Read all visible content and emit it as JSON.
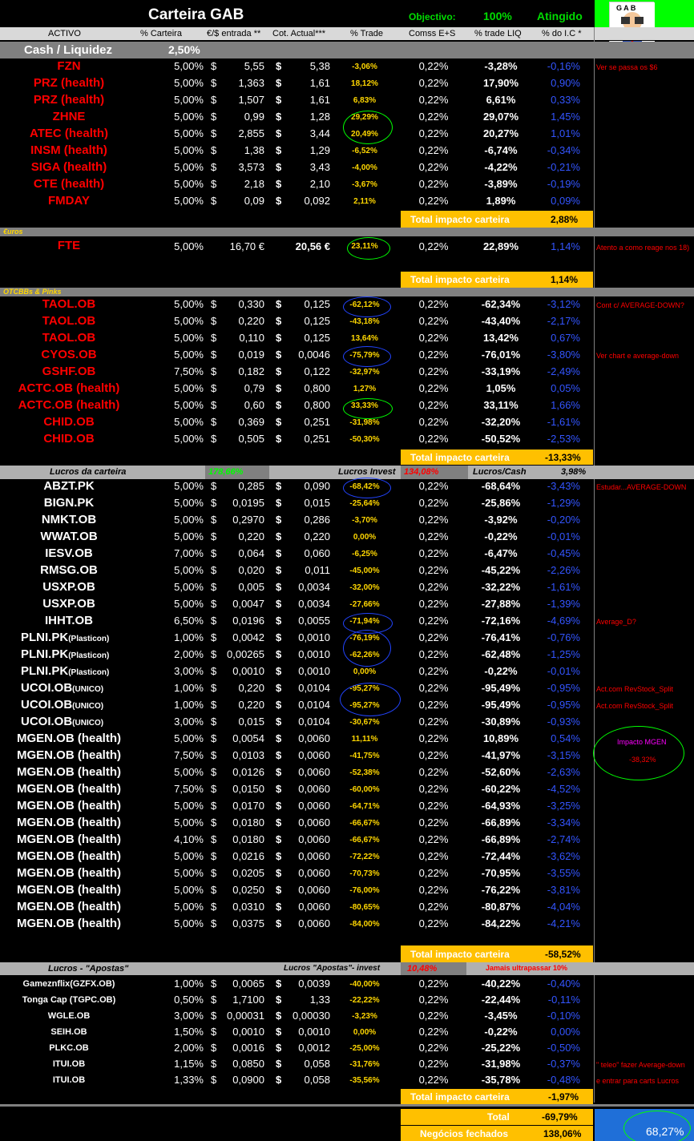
{
  "title": "Carteira GAB",
  "objective_label": "Objectivo:",
  "objective_value": "100%",
  "objective_status": "Atingido",
  "logo_text": "G A B",
  "headers": [
    "ACTIVO",
    "% Carteira",
    "€/$ entrada **",
    "Cot. Actual***",
    "% Trade",
    "Comss E+S",
    "% trade LIQ",
    "% do I.C *"
  ],
  "cash": {
    "label": "Cash / Liquidez",
    "value": "2,50%"
  },
  "group1": [
    {
      "a": "FZN",
      "p": "5,00%",
      "d1": "$",
      "e": "5,55",
      "d2": "$",
      "c": "5,38",
      "t": "-3,06%",
      "m": "0,22%",
      "l": "-3,28%",
      "i": "-0,16%",
      "n": "Ver se passa os $6"
    },
    {
      "a": "PRZ  (health)",
      "p": "5,00%",
      "d1": "$",
      "e": "1,363",
      "d2": "$",
      "c": "1,61",
      "t": "18,12%",
      "m": "0,22%",
      "l": "17,90%",
      "i": "0,90%",
      "n": ""
    },
    {
      "a": "PRZ  (health)",
      "p": "5,00%",
      "d1": "$",
      "e": "1,507",
      "d2": "$",
      "c": "1,61",
      "t": "6,83%",
      "m": "0,22%",
      "l": "6,61%",
      "i": "0,33%",
      "n": ""
    },
    {
      "a": "ZHNE",
      "p": "5,00%",
      "d1": "$",
      "e": "0,99",
      "d2": "$",
      "c": "1,28",
      "t": "29,29%",
      "m": "0,22%",
      "l": "29,07%",
      "i": "1,45%",
      "n": ""
    },
    {
      "a": "ATEC  (health)",
      "p": "5,00%",
      "d1": "$",
      "e": "2,855",
      "d2": "$",
      "c": "3,44",
      "t": "20,49%",
      "m": "0,22%",
      "l": "20,27%",
      "i": "1,01%",
      "n": ""
    },
    {
      "a": "INSM  (health)",
      "p": "5,00%",
      "d1": "$",
      "e": "1,38",
      "d2": "$",
      "c": "1,29",
      "t": "-6,52%",
      "m": "0,22%",
      "l": "-6,74%",
      "i": "-0,34%",
      "n": ""
    },
    {
      "a": "SIGA  (health)",
      "p": "5,00%",
      "d1": "$",
      "e": "3,573",
      "d2": "$",
      "c": "3,43",
      "t": "-4,00%",
      "m": "0,22%",
      "l": "-4,22%",
      "i": "-0,21%",
      "n": ""
    },
    {
      "a": "CTE  (health)",
      "p": "5,00%",
      "d1": "$",
      "e": "2,18",
      "d2": "$",
      "c": "2,10",
      "t": "-3,67%",
      "m": "0,22%",
      "l": "-3,89%",
      "i": "-0,19%",
      "n": ""
    },
    {
      "a": "FMDAY",
      "p": "5,00%",
      "d1": "$",
      "e": "0,09",
      "d2": "$",
      "c": "0,092",
      "t": "2,11%",
      "m": "0,22%",
      "l": "1,89%",
      "i": "0,09%",
      "n": ""
    }
  ],
  "total1": {
    "label": "Total impacto carteira",
    "value": "2,88%"
  },
  "euros_label": "€uros",
  "fte": {
    "a": "FTE",
    "p": "5,00%",
    "e": "16,70 €",
    "c": "20,56 €",
    "t": "23,11%",
    "m": "0,22%",
    "l": "22,89%",
    "i": "1,14%",
    "n": "Atento a como reage nos 18)"
  },
  "total2": {
    "label": "Total impacto carteira",
    "value": "1,14%"
  },
  "otc_label": "OTCBBs & Pinks",
  "group2": [
    {
      "a": "TAOL.OB",
      "p": "5,00%",
      "d1": "$",
      "e": "0,330",
      "d2": "$",
      "c": "0,125",
      "t": "-62,12%",
      "m": "0,22%",
      "l": "-62,34%",
      "i": "-3,12%",
      "n": "Cont c/  AVERAGE-DOWN?"
    },
    {
      "a": "TAOL.OB",
      "p": "5,00%",
      "d1": "$",
      "e": "0,220",
      "d2": "$",
      "c": "0,125",
      "t": "-43,18%",
      "m": "0,22%",
      "l": "-43,40%",
      "i": "-2,17%",
      "n": ""
    },
    {
      "a": "TAOL.OB",
      "p": "5,00%",
      "d1": "$",
      "e": "0,110",
      "d2": "$",
      "c": "0,125",
      "t": "13,64%",
      "m": "0,22%",
      "l": "13,42%",
      "i": "0,67%",
      "n": ""
    },
    {
      "a": "CYOS.OB",
      "p": "5,00%",
      "d1": "$",
      "e": "0,019",
      "d2": "$",
      "c": "0,0046",
      "t": "-75,79%",
      "m": "0,22%",
      "l": "-76,01%",
      "i": "-3,80%",
      "n": "Ver chart e average-down"
    },
    {
      "a": "GSHF.OB",
      "p": "7,50%",
      "d1": "$",
      "e": "0,182",
      "d2": "$",
      "c": "0,122",
      "t": "-32,97%",
      "m": "0,22%",
      "l": "-33,19%",
      "i": "-2,49%",
      "n": ""
    },
    {
      "a": "ACTC.OB  (health)",
      "p": "5,00%",
      "d1": "$",
      "e": "0,79",
      "d2": "$",
      "c": "0,800",
      "t": "1,27%",
      "m": "0,22%",
      "l": "1,05%",
      "i": "0,05%",
      "n": ""
    },
    {
      "a": "ACTC.OB  (health)",
      "p": "5,00%",
      "d1": "$",
      "e": "0,60",
      "d2": "$",
      "c": "0,800",
      "t": "33,33%",
      "m": "0,22%",
      "l": "33,11%",
      "i": "1,66%",
      "n": ""
    },
    {
      "a": "CHID.OB",
      "p": "5,00%",
      "d1": "$",
      "e": "0,369",
      "d2": "$",
      "c": "0,251",
      "t": "-31,98%",
      "m": "0,22%",
      "l": "-32,20%",
      "i": "-1,61%",
      "n": ""
    },
    {
      "a": "CHID.OB",
      "p": "5,00%",
      "d1": "$",
      "e": "0,505",
      "d2": "$",
      "c": "0,251",
      "t": "-50,30%",
      "m": "0,22%",
      "l": "-50,52%",
      "i": "-2,53%",
      "n": ""
    }
  ],
  "total3": {
    "label": "Total impacto carteira",
    "value": "-13,33%"
  },
  "lucros_bar": {
    "l1": "Lucros da carteira",
    "v1": "178,66%",
    "l2": "Lucros Invest",
    "v2": "134,08%",
    "l3": "Lucros/Cash",
    "v3": "3,98%"
  },
  "group3": [
    {
      "a": "ABZT.PK",
      "p": "5,00%",
      "d1": "$",
      "e": "0,285",
      "d2": "$",
      "c": "0,090",
      "t": "-68,42%",
      "m": "0,22%",
      "l": "-68,64%",
      "i": "-3,43%",
      "n": "Estudar...AVERAGE-DOWN"
    },
    {
      "a": "BIGN.PK",
      "p": "5,00%",
      "d1": "$",
      "e": "0,0195",
      "d2": "$",
      "c": "0,015",
      "t": "-25,64%",
      "m": "0,22%",
      "l": "-25,86%",
      "i": "-1,29%",
      "n": ""
    },
    {
      "a": "NMKT.OB",
      "p": "5,00%",
      "d1": "$",
      "e": "0,2970",
      "d2": "$",
      "c": "0,286",
      "t": "-3,70%",
      "m": "0,22%",
      "l": "-3,92%",
      "i": "-0,20%",
      "n": ""
    },
    {
      "a": "WWAT.OB",
      "p": "5,00%",
      "d1": "$",
      "e": "0,220",
      "d2": "$",
      "c": "0,220",
      "t": "0,00%",
      "m": "0,22%",
      "l": "-0,22%",
      "i": "-0,01%",
      "n": ""
    },
    {
      "a": "IESV.OB",
      "p": "7,00%",
      "d1": "$",
      "e": "0,064",
      "d2": "$",
      "c": "0,060",
      "t": "-6,25%",
      "m": "0,22%",
      "l": "-6,47%",
      "i": "-0,45%",
      "n": ""
    },
    {
      "a": "RMSG.OB",
      "p": "5,00%",
      "d1": "$",
      "e": "0,020",
      "d2": "$",
      "c": "0,011",
      "t": "-45,00%",
      "m": "0,22%",
      "l": "-45,22%",
      "i": "-2,26%",
      "n": ""
    },
    {
      "a": "USXP.OB",
      "p": "5,00%",
      "d1": "$",
      "e": "0,005",
      "d2": "$",
      "c": "0,0034",
      "t": "-32,00%",
      "m": "0,22%",
      "l": "-32,22%",
      "i": "-1,61%",
      "n": ""
    },
    {
      "a": "USXP.OB",
      "p": "5,00%",
      "d1": "$",
      "e": "0,0047",
      "d2": "$",
      "c": "0,0034",
      "t": "-27,66%",
      "m": "0,22%",
      "l": "-27,88%",
      "i": "-1,39%",
      "n": ""
    },
    {
      "a": "IHHT.OB",
      "p": "6,50%",
      "d1": "$",
      "e": "0,0196",
      "d2": "$",
      "c": "0,0055",
      "t": "-71,94%",
      "m": "0,22%",
      "l": "-72,16%",
      "i": "-4,69%",
      "n": "Average_D?"
    },
    {
      "a": "PLNI.PK",
      "s": "(Plasticon)",
      "p": "1,00%",
      "d1": "$",
      "e": "0,0042",
      "d2": "$",
      "c": "0,0010",
      "t": "-76,19%",
      "m": "0,22%",
      "l": "-76,41%",
      "i": "-0,76%",
      "n": ""
    },
    {
      "a": "PLNI.PK",
      "s": "(Plasticon)",
      "p": "2,00%",
      "d1": "$",
      "e": "0,00265",
      "d2": "$",
      "c": "0,0010",
      "t": "-62,26%",
      "m": "0,22%",
      "l": "-62,48%",
      "i": "-1,25%",
      "n": ""
    },
    {
      "a": "PLNI.PK",
      "s": "(Plasticon)",
      "p": "3,00%",
      "d1": "$",
      "e": "0,0010",
      "d2": "$",
      "c": "0,0010",
      "t": "0,00%",
      "m": "0,22%",
      "l": "-0,22%",
      "i": "-0,01%",
      "n": ""
    },
    {
      "a": "UCOI.OB",
      "s": "(UNICO)",
      "p": "1,00%",
      "d1": "$",
      "e": "0,220",
      "d2": "$",
      "c": "0,0104",
      "t": "-95,27%",
      "m": "0,22%",
      "l": "-95,49%",
      "i": "-0,95%",
      "n": "Act.com RevStock_Split"
    },
    {
      "a": "UCOI.OB",
      "s": "(UNICO)",
      "p": "1,00%",
      "d1": "$",
      "e": "0,220",
      "d2": "$",
      "c": "0,0104",
      "t": "-95,27%",
      "m": "0,22%",
      "l": "-95,49%",
      "i": "-0,95%",
      "n": "Act.com RevStock_Split"
    },
    {
      "a": "UCOI.OB",
      "s": "(UNICO)",
      "p": "3,00%",
      "d1": "$",
      "e": "0,015",
      "d2": "$",
      "c": "0,0104",
      "t": "-30,67%",
      "m": "0,22%",
      "l": "-30,89%",
      "i": "-0,93%",
      "n": ""
    },
    {
      "a": "MGEN.OB  (health)",
      "p": "5,00%",
      "d1": "$",
      "e": "0,0054",
      "d2": "$",
      "c": "0,0060",
      "t": "11,11%",
      "m": "0,22%",
      "l": "10,89%",
      "i": "0,54%",
      "n": ""
    },
    {
      "a": "MGEN.OB  (health)",
      "p": "7,50%",
      "d1": "$",
      "e": "0,0103",
      "d2": "$",
      "c": "0,0060",
      "t": "-41,75%",
      "m": "0,22%",
      "l": "-41,97%",
      "i": "-3,15%",
      "n": ""
    },
    {
      "a": "MGEN.OB  (health)",
      "p": "5,00%",
      "d1": "$",
      "e": "0,0126",
      "d2": "$",
      "c": "0,0060",
      "t": "-52,38%",
      "m": "0,22%",
      "l": "-52,60%",
      "i": "-2,63%",
      "n": ""
    },
    {
      "a": "MGEN.OB  (health)",
      "p": "7,50%",
      "d1": "$",
      "e": "0,0150",
      "d2": "$",
      "c": "0,0060",
      "t": "-60,00%",
      "m": "0,22%",
      "l": "-60,22%",
      "i": "-4,52%",
      "n": ""
    },
    {
      "a": "MGEN.OB  (health)",
      "p": "5,00%",
      "d1": "$",
      "e": "0,0170",
      "d2": "$",
      "c": "0,0060",
      "t": "-64,71%",
      "m": "0,22%",
      "l": "-64,93%",
      "i": "-3,25%",
      "n": ""
    },
    {
      "a": "MGEN.OB  (health)",
      "p": "5,00%",
      "d1": "$",
      "e": "0,0180",
      "d2": "$",
      "c": "0,0060",
      "t": "-66,67%",
      "m": "0,22%",
      "l": "-66,89%",
      "i": "-3,34%",
      "n": ""
    },
    {
      "a": "MGEN.OB  (health)",
      "p": "4,10%",
      "d1": "$",
      "e": "0,0180",
      "d2": "$",
      "c": "0,0060",
      "t": "-66,67%",
      "m": "0,22%",
      "l": "-66,89%",
      "i": "-2,74%",
      "n": ""
    },
    {
      "a": "MGEN.OB  (health)",
      "p": "5,00%",
      "d1": "$",
      "e": "0,0216",
      "d2": "$",
      "c": "0,0060",
      "t": "-72,22%",
      "m": "0,22%",
      "l": "-72,44%",
      "i": "-3,62%",
      "n": ""
    },
    {
      "a": "MGEN.OB  (health)",
      "p": "5,00%",
      "d1": "$",
      "e": "0,0205",
      "d2": "$",
      "c": "0,0060",
      "t": "-70,73%",
      "m": "0,22%",
      "l": "-70,95%",
      "i": "-3,55%",
      "n": ""
    },
    {
      "a": "MGEN.OB  (health)",
      "p": "5,00%",
      "d1": "$",
      "e": "0,0250",
      "d2": "$",
      "c": "0,0060",
      "t": "-76,00%",
      "m": "0,22%",
      "l": "-76,22%",
      "i": "-3,81%",
      "n": ""
    },
    {
      "a": "MGEN.OB  (health)",
      "p": "5,00%",
      "d1": "$",
      "e": "0,0310",
      "d2": "$",
      "c": "0,0060",
      "t": "-80,65%",
      "m": "0,22%",
      "l": "-80,87%",
      "i": "-4,04%",
      "n": ""
    },
    {
      "a": "MGEN.OB  (health)",
      "p": "5,00%",
      "d1": "$",
      "e": "0,0375",
      "d2": "$",
      "c": "0,0060",
      "t": "-84,00%",
      "m": "0,22%",
      "l": "-84,22%",
      "i": "-4,21%",
      "n": ""
    }
  ],
  "mgen_note": {
    "l1": "Impacto MGEN",
    "l2": "-38,32%"
  },
  "total4": {
    "label": "Total impacto carteira",
    "value": "-58,52%"
  },
  "apostas_bar": {
    "l1": "Lucros - \"Apostas\"",
    "l2": "Lucros \"Apostas\"- invest",
    "v2": "10,48%",
    "warn": "Jamais ultrapassar 10%"
  },
  "group4": [
    {
      "a": "Gameznflix(GZFX.OB)",
      "p": "1,00%",
      "d1": "$",
      "e": "0,0065",
      "d2": "$",
      "c": "0,0039",
      "t": "-40,00%",
      "m": "0,22%",
      "l": "-40,22%",
      "i": "-0,40%",
      "n": ""
    },
    {
      "a": "Tonga Cap (TGPC.OB)",
      "p": "0,50%",
      "d1": "$",
      "e": "1,7100",
      "d2": "$",
      "c": "1,33",
      "t": "-22,22%",
      "m": "0,22%",
      "l": "-22,44%",
      "i": "-0,11%",
      "n": ""
    },
    {
      "a": "WGLE.OB",
      "p": "3,00%",
      "d1": "$",
      "e": "0,00031",
      "d2": "$",
      "c": "0,00030",
      "t": "-3,23%",
      "m": "0,22%",
      "l": "-3,45%",
      "i": "-0,10%",
      "n": ""
    },
    {
      "a": "SEIH.OB",
      "p": "1,50%",
      "d1": "$",
      "e": "0,0010",
      "d2": "$",
      "c": "0,0010",
      "t": "0,00%",
      "m": "0,22%",
      "l": "-0,22%",
      "i": "0,00%",
      "n": ""
    },
    {
      "a": "PLKC.OB",
      "p": "2,00%",
      "d1": "$",
      "e": "0,0016",
      "d2": "$",
      "c": "0,0012",
      "t": "-25,00%",
      "m": "0,22%",
      "l": "-25,22%",
      "i": "-0,50%",
      "n": ""
    },
    {
      "a": "ITUI.OB",
      "p": "1,15%",
      "d1": "$",
      "e": "0,0850",
      "d2": "$",
      "c": "0,058",
      "t": "-31,76%",
      "m": "0,22%",
      "l": "-31,98%",
      "i": "-0,37%",
      "n": "\" teleo\" fazer Average-down"
    },
    {
      "a": "ITUI.OB",
      "p": "1,33%",
      "d1": "$",
      "e": "0,0900",
      "d2": "$",
      "c": "0,058",
      "t": "-35,56%",
      "m": "0,22%",
      "l": "-35,78%",
      "i": "-0,48%",
      "n": "e entrar para carts Lucros"
    }
  ],
  "total5": {
    "label": "Total impacto carteira",
    "value": "-1,97%"
  },
  "final": {
    "total_label": "Total",
    "total_value": "-69,79%",
    "closed_label": "Negócios fechados",
    "closed_value": "138,06%",
    "blue_value": "68,27%"
  }
}
